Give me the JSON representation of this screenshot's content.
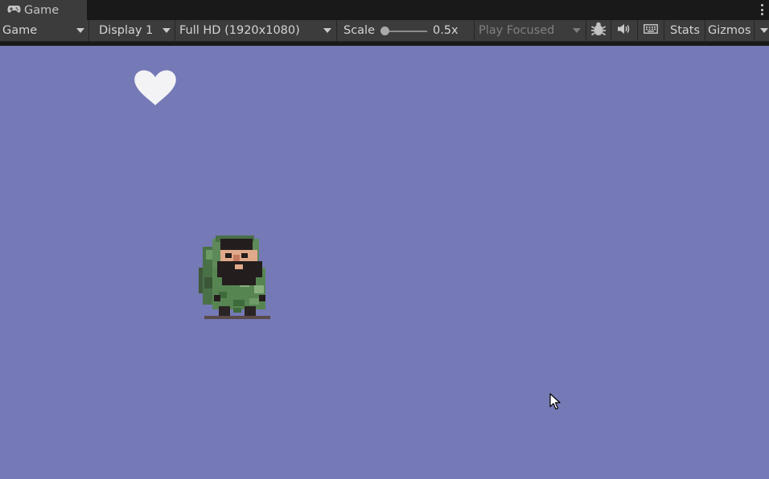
{
  "window": {
    "tab": {
      "label": "Game",
      "icon": "gamepad-icon"
    },
    "menu_icon": "kebab-menu-icon"
  },
  "toolbar": {
    "view_dropdown": "Game",
    "display_dropdown": "Display 1",
    "resolution_dropdown": "Full HD (1920x1080)",
    "scale_label": "Scale",
    "scale_value": "0.5x",
    "scale_fraction": 0.0,
    "play_mode_dropdown": "Play Focused",
    "icons": [
      "bug-icon",
      "speaker-icon",
      "keyboard-icon"
    ],
    "stats_label": "Stats",
    "gizmos_label": "Gizmos"
  },
  "game": {
    "background_color": "#7579b6",
    "hud_icon": "heart-icon",
    "character": "bearded-hiker-sprite"
  },
  "colors": {
    "panel": "#3c3c3c",
    "dark": "#191919",
    "text": "#d4d4d4",
    "disabled_text": "#808080"
  }
}
